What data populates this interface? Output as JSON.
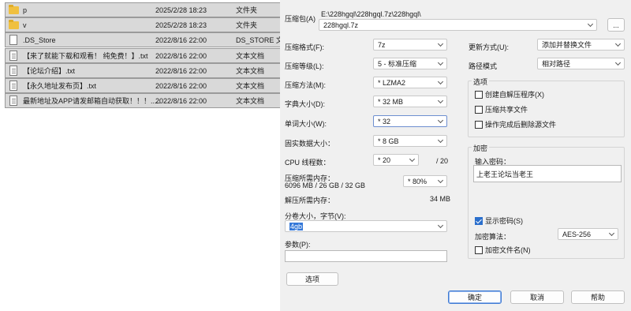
{
  "explorer": {
    "files": [
      {
        "name": "p",
        "date": "2025/2/28 18:23",
        "type": "文件夹",
        "icon": "folder-icon"
      },
      {
        "name": "v",
        "date": "2025/2/28 18:23",
        "type": "文件夹",
        "icon": "folder-icon"
      },
      {
        "name": ".DS_Store",
        "date": "2022/8/16 22:00",
        "type": "DS_STORE 文",
        "icon": "file-icon"
      },
      {
        "name": "【来了就能下载和观看！ 纯免费！】.txt",
        "date": "2022/8/16 22:00",
        "type": "文本文档",
        "icon": "text-file-icon"
      },
      {
        "name": "【论坛介绍】.txt",
        "date": "2022/8/16 22:00",
        "type": "文本文档",
        "icon": "text-file-icon"
      },
      {
        "name": "【永久地址发布页】.txt",
        "date": "2022/8/16 22:00",
        "type": "文本文档",
        "icon": "text-file-icon"
      },
      {
        "name": "最新地址及APP请发邮箱自动获取！！！.....",
        "date": "2022/8/16 22:00",
        "type": "文本文档",
        "icon": "text-file-icon"
      }
    ]
  },
  "dialog": {
    "archive_label": "压缩包(A)",
    "archive_path": "E:\\228hgql\\228hgql.7z\\228hgql\\",
    "archive_name": "228hgql.7z",
    "browse_button": "...",
    "format_label": "压缩格式(F):",
    "format_value": "7z",
    "level_label": "压缩等级(L):",
    "level_value": "5 - 标准压缩",
    "method_label": "压缩方法(M):",
    "method_value": "* LZMA2",
    "dict_label": "字典大小(D):",
    "dict_value": "* 32 MB",
    "word_label": "单词大小(W):",
    "word_value": "* 32",
    "solid_label": "固实数据大小：",
    "solid_value": "* 8 GB",
    "cpu_label": "CPU 线程数：",
    "cpu_value": "* 20",
    "cpu_total": "/ 20",
    "mem_compress_label": "压缩所需内存：",
    "mem_compress_detail": "6096 MB / 26 GB / 32 GB",
    "mem_compress_value": "* 80%",
    "mem_decompress_label": "解压所需内存：",
    "mem_decompress_value": "34 MB",
    "volume_label": "分卷大小，字节(V):",
    "volume_value": "4gb",
    "params_label": "参数(P):",
    "params_value": "",
    "options_button": "选项",
    "update_label": "更新方式(U):",
    "update_value": "添加并替换文件",
    "path_label": "路径模式",
    "path_value": "相对路径",
    "options_group": "选项",
    "opt_sfx": "创建自解压程序(X)",
    "opt_shared": "压缩共享文件",
    "opt_delete": "操作完成后删除源文件",
    "encrypt_group": "加密",
    "password_label": "输入密码：",
    "password_value": "上老王论坛当老王",
    "show_password": "显示密码(S)",
    "encrypt_method_label": "加密算法：",
    "encrypt_method_value": "AES-256",
    "encrypt_names": "加密文件名(N)",
    "ok_button": "确定",
    "cancel_button": "取消",
    "help_button": "帮助"
  },
  "colors": {
    "dialog_bg": "#f0f0f0",
    "selection_row": "#d9d9d9",
    "checkbox_accent": "#2b6fcc",
    "folder": "#f0c040"
  }
}
